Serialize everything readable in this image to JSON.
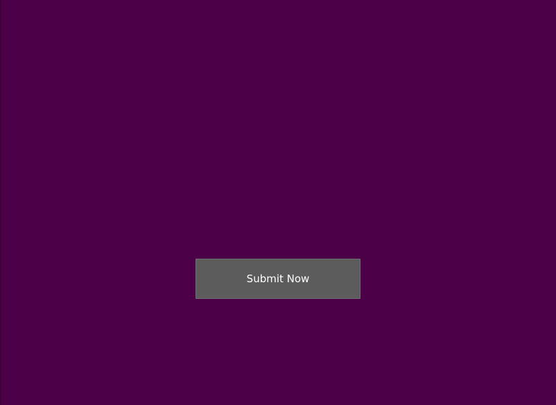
{
  "form": {
    "submit_label": "Submit Now"
  },
  "colors": {
    "background": "#4c0048",
    "button_background": "#5c5c5c",
    "button_text": "#ffffff"
  }
}
